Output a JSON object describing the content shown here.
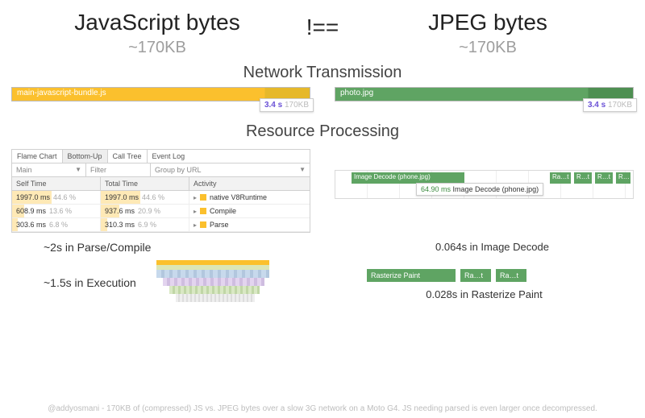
{
  "header": {
    "js_title": "JavaScript bytes",
    "neq": "!==",
    "jpg_title": "JPEG bytes",
    "js_size": "~170KB",
    "jpg_size": "~170KB"
  },
  "sections": {
    "network": "Network Transmission",
    "processing": "Resource Processing"
  },
  "network": {
    "js": {
      "filename": "main-javascript-bundle.js",
      "time": "3.4 s",
      "size": "170KB"
    },
    "jpg": {
      "filename": "photo.jpg",
      "time": "3.4 s",
      "size": "170KB"
    }
  },
  "devtools": {
    "tabs": [
      "Flame Chart",
      "Bottom-Up",
      "Call Tree",
      "Event Log"
    ],
    "active_tab_index": 1,
    "main_label": "Main",
    "filter_placeholder": "Filter",
    "group_label": "Group by URL",
    "columns": [
      "Self Time",
      "Total Time",
      "Activity"
    ],
    "rows": [
      {
        "self_ms": "1997.0 ms",
        "self_pct": "44.6 %",
        "self_bar": 44.6,
        "total_ms": "1997.0 ms",
        "total_pct": "44.6 %",
        "total_bar": 44.6,
        "activity": "native V8Runtime"
      },
      {
        "self_ms": "608.9 ms",
        "self_pct": "13.6 %",
        "self_bar": 13.6,
        "total_ms": "937.6 ms",
        "total_pct": "20.9 %",
        "total_bar": 20.9,
        "activity": "Compile"
      },
      {
        "self_ms": "303.6 ms",
        "self_pct": "6.8 %",
        "self_bar": 6.8,
        "total_ms": "310.3 ms",
        "total_pct": "6.9 %",
        "total_bar": 6.9,
        "activity": "Parse"
      }
    ]
  },
  "image_decode": {
    "main_label": "Image Decode (phone.jpg)",
    "tip_time": "64.90 ms",
    "tip_label": "Image Decode (phone.jpg)",
    "mini": [
      "Ra…t",
      "R…t",
      "R…t",
      "R…"
    ]
  },
  "stats": {
    "js_parse": "~2s in Parse/Compile",
    "js_exec": "~1.5s in Execution",
    "img_decode": "0.064s in Image Decode",
    "img_raster": "0.028s in Rasterize Paint"
  },
  "raster": {
    "blocks": [
      "Rasterize Paint",
      "Ra…t",
      "Ra…t"
    ]
  },
  "footer": "@addyosmani - 170KB of (compressed) JS vs. JPEG bytes over a slow 3G network on a Moto G4. JS needing parsed is even larger once decompressed."
}
